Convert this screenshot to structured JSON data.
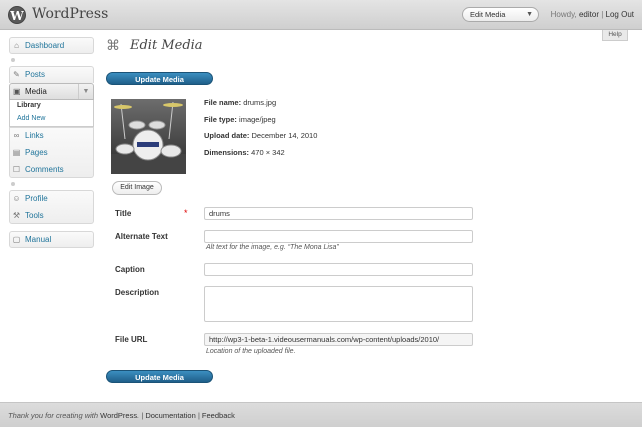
{
  "header": {
    "site_title": "WordPress",
    "favorites_label": "Edit Media",
    "howdy": "Howdy,",
    "username": "editor",
    "separator": "|",
    "logout": "Log Out",
    "help_tab": "Help"
  },
  "sidebar": {
    "items": [
      {
        "label": "Dashboard",
        "icon": "dashboard-icon"
      },
      {
        "label": "Posts",
        "icon": "posts-icon"
      },
      {
        "label": "Media",
        "icon": "media-icon"
      },
      {
        "label": "Links",
        "icon": "links-icon"
      },
      {
        "label": "Pages",
        "icon": "pages-icon"
      },
      {
        "label": "Comments",
        "icon": "comments-icon"
      },
      {
        "label": "Profile",
        "icon": "profile-icon"
      },
      {
        "label": "Tools",
        "icon": "tools-icon"
      },
      {
        "label": "Manual",
        "icon": "manual-icon"
      }
    ],
    "media_submenu": [
      "Library",
      "Add New"
    ]
  },
  "main": {
    "title": "Edit Media",
    "update_button": "Update Media",
    "edit_image_button": "Edit Image",
    "file_info": {
      "name_label": "File name:",
      "name_value": "drums.jpg",
      "type_label": "File type:",
      "type_value": "image/jpeg",
      "date_label": "Upload date:",
      "date_value": "December 14, 2010",
      "dim_label": "Dimensions:",
      "dim_value": "470 × 342"
    },
    "fields": {
      "title_label": "Title",
      "title_value": "drums",
      "required_mark": "*",
      "alt_label": "Alternate Text",
      "alt_value": "",
      "alt_help": "Alt text for the image, e.g. “The Mona Lisa”",
      "caption_label": "Caption",
      "caption_value": "",
      "description_label": "Description",
      "description_value": "",
      "url_label": "File URL",
      "url_value": "http://wp3-1-beta-1.videousermanuals.com/wp-content/uploads/2010/",
      "url_help": "Location of the uploaded file."
    }
  },
  "footer": {
    "thanks": "Thank you for creating with",
    "wordpress": "WordPress",
    "period": ". |",
    "documentation": "Documentation",
    "pipe": "|",
    "feedback": "Feedback"
  },
  "colors": {
    "accent": "#21759b",
    "button": "#2a73a3",
    "required": "#dd0000"
  }
}
